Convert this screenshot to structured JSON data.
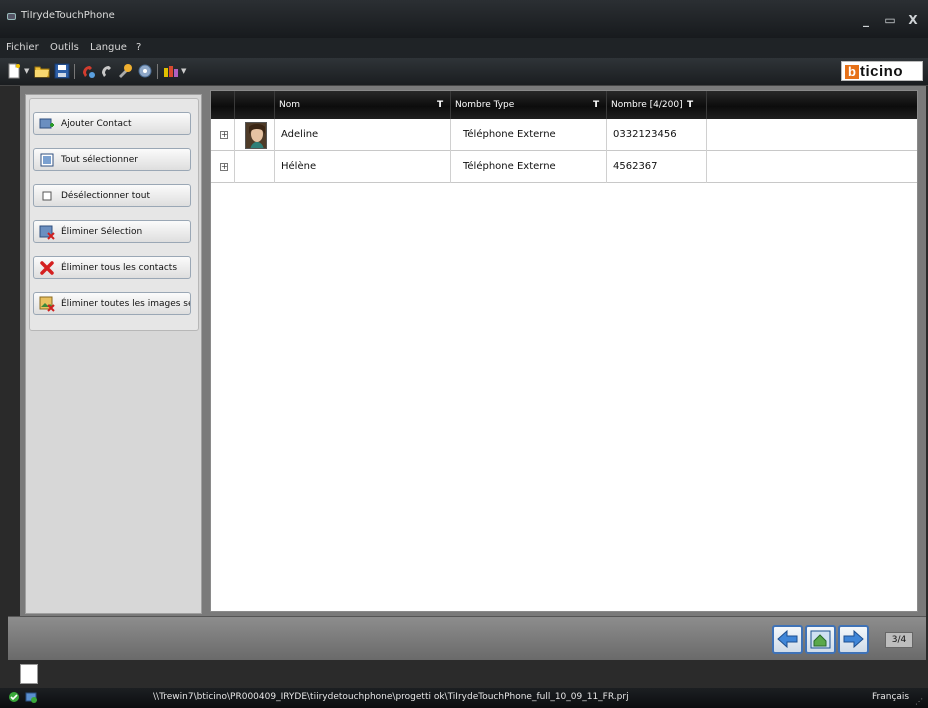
{
  "window": {
    "title": "TiIrydeTouchPhone",
    "min": "_",
    "max": "▭",
    "close": "X"
  },
  "menu": [
    "Fichier",
    "Outils",
    "Langue",
    "?"
  ],
  "brand": {
    "logo_b": "b",
    "logo_rest": "ticino",
    "accent": "#e67017"
  },
  "sidebar": {
    "buttons": [
      {
        "label": "Ajouter Contact",
        "icon": "add-contact-icon"
      },
      {
        "label": "Tout sélectionner",
        "icon": "select-all-icon"
      },
      {
        "label": "Désélectionner tout",
        "icon": "checkbox-icon"
      },
      {
        "label": "Éliminer Sélection",
        "icon": "delete-selection-icon"
      },
      {
        "label": "Éliminer tous les contacts",
        "icon": "red-x-icon"
      },
      {
        "label": "Éliminer toutes les images sélec",
        "icon": "delete-images-icon"
      }
    ]
  },
  "grid": {
    "columns": [
      {
        "label": ""
      },
      {
        "label": ""
      },
      {
        "label": "Nom",
        "filter": "T"
      },
      {
        "label": "Nombre Type",
        "filter": "T"
      },
      {
        "label": "Nombre [4/200]",
        "filter": "T"
      },
      {
        "label": ""
      }
    ],
    "rows": [
      {
        "expander": "+",
        "has_photo": true,
        "nom": "Adeline",
        "type": "Téléphone Externe",
        "number": "0332123456"
      },
      {
        "expander": "+",
        "has_photo": false,
        "nom": "Hélène",
        "type": "Téléphone Externe",
        "number": "4562367"
      }
    ]
  },
  "nav": {
    "page": "3/4",
    "buttons": [
      "back-arrow-icon",
      "home-icon",
      "forward-arrow-icon"
    ]
  },
  "status": {
    "path": "\\\\Trewin7\\bticino\\PR000409_IRYDE\\tiirydetouchphone\\progetti ok\\TiIrydeTouchPhone_full_10_09_11_FR.prj",
    "language": "Français"
  }
}
